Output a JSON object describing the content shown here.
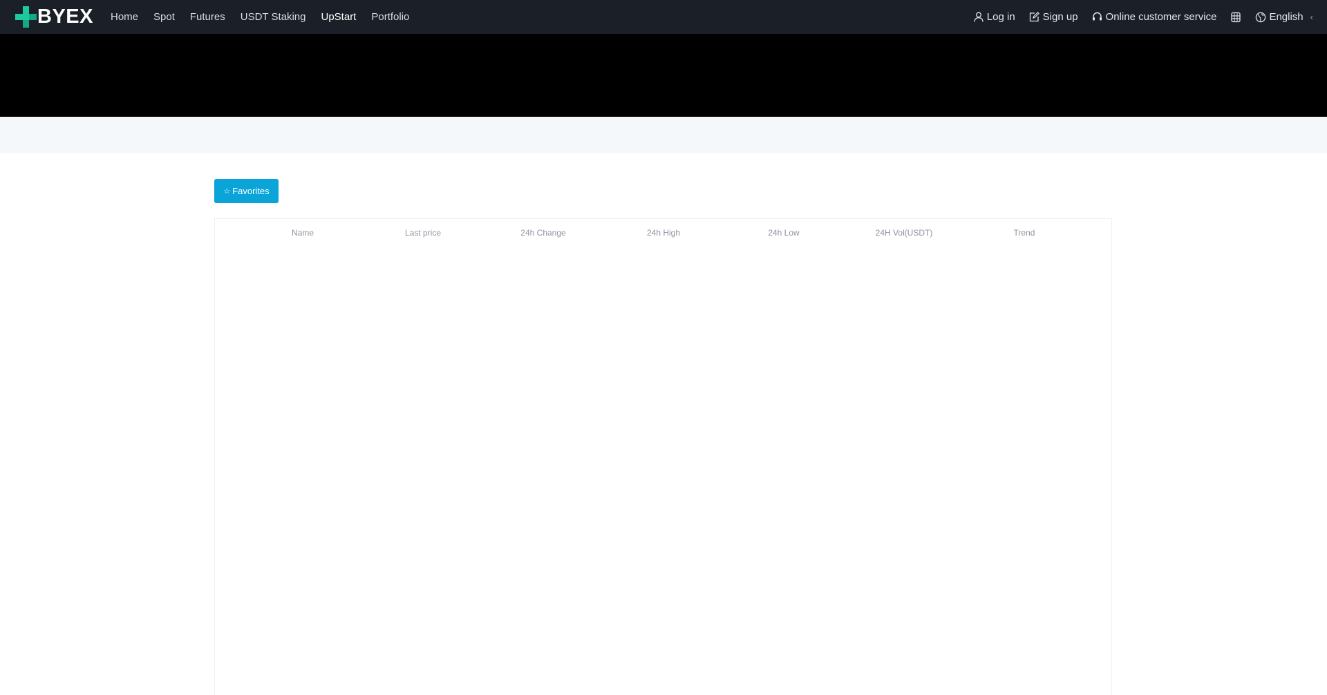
{
  "brand": {
    "name": "BYEX",
    "accent_color": "#1ec8a0"
  },
  "nav": {
    "links": [
      {
        "label": "Home"
      },
      {
        "label": "Spot"
      },
      {
        "label": "Futures"
      },
      {
        "label": "USDT Staking"
      },
      {
        "label": "UpStart"
      },
      {
        "label": "Portfolio"
      }
    ],
    "active": "UpStart"
  },
  "header_right": {
    "login": {
      "label": "Log in",
      "icon": "user-icon"
    },
    "signup": {
      "label": "Sign up",
      "icon": "edit-icon"
    },
    "support": {
      "label": "Online customer service",
      "icon": "headset-icon"
    },
    "download": {
      "icon": "download-app-icon"
    },
    "language": {
      "label": "English",
      "icon": "globe-icon",
      "chevron": "‹"
    }
  },
  "favorites": {
    "label": "Favorites",
    "icon": "star-icon",
    "color": "#0aa4d8"
  },
  "market_table": {
    "columns": [
      "Name",
      "Last price",
      "24h Change",
      "24h High",
      "24h Low",
      "24H Vol(USDT)",
      "Trend"
    ],
    "rows": []
  }
}
